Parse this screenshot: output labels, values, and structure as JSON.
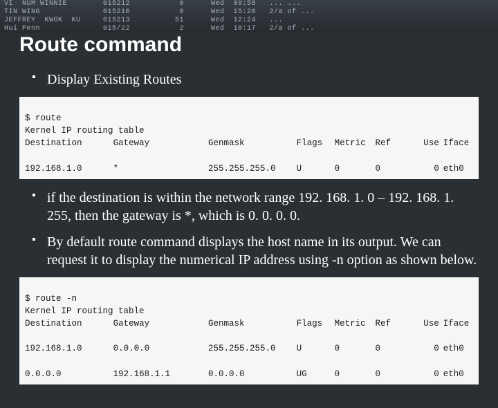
{
  "header_lines": [
    "VI  NUM WINNIE        015212           0      Wed  09:58   ... ...",
    "TIN WING              015210           0      Wed  15:20   2/a of ...",
    "JEFFREY  KWOK  KU     015213          51      Wed  12:24   ...",
    "Hui Penn              015/22           2      Wed  10:17   2/a of ..."
  ],
  "title": "Route command",
  "bullets": {
    "b1": "Display Existing Routes",
    "b2": "if the destination is within the network range 192. 168. 1. 0 – 192. 168. 1. 255, then the gateway is *, which is 0. 0. 0. 0.",
    "b3": "By default route command displays the host name in its output. We can request it to display the numerical IP address using -n option as shown below."
  },
  "term1": {
    "command": "$ route",
    "subtitle": "Kernel IP routing table",
    "columns": [
      "Destination",
      "Gateway",
      "Genmask",
      "Flags",
      "Metric",
      "Ref",
      "Use",
      "Iface"
    ],
    "rows": [
      {
        "dest": "192.168.1.0",
        "gateway": "*",
        "genmask": "255.255.255.0",
        "flags": "U",
        "metric": "0",
        "ref": "0",
        "use": "0",
        "iface": "eth0"
      }
    ]
  },
  "term2": {
    "command": "$ route -n",
    "subtitle": "Kernel IP routing table",
    "columns": [
      "Destination",
      "Gateway",
      "Genmask",
      "Flags",
      "Metric",
      "Ref",
      "Use",
      "Iface"
    ],
    "rows": [
      {
        "dest": "192.168.1.0",
        "gateway": "0.0.0.0",
        "genmask": "255.255.255.0",
        "flags": "U",
        "metric": "0",
        "ref": "0",
        "use": "0",
        "iface": "eth0"
      },
      {
        "dest": "0.0.0.0",
        "gateway": "192.168.1.1",
        "genmask": "0.0.0.0",
        "flags": "UG",
        "metric": "0",
        "ref": "0",
        "use": "0",
        "iface": "eth0"
      }
    ]
  }
}
